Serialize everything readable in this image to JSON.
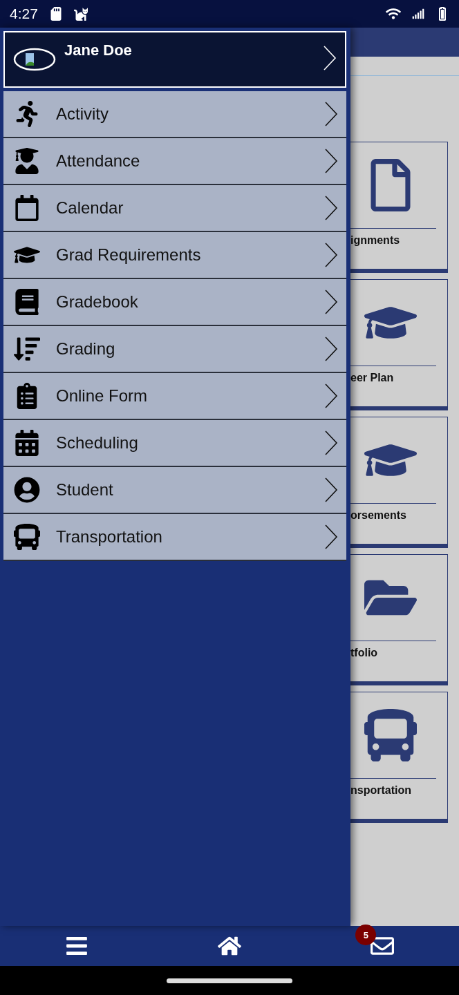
{
  "status_bar": {
    "time": "4:27"
  },
  "drawer": {
    "profile": {
      "name": "Jane Doe"
    },
    "items": [
      {
        "label": "Activity",
        "kind": "running"
      },
      {
        "label": "Attendance",
        "kind": "graduate"
      },
      {
        "label": "Calendar",
        "kind": "calendar"
      },
      {
        "label": "Grad Requirements",
        "kind": "cap"
      },
      {
        "label": "Gradebook",
        "kind": "book"
      },
      {
        "label": "Grading",
        "kind": "bars"
      },
      {
        "label": "Online Form",
        "kind": "clipboard"
      },
      {
        "label": "Scheduling",
        "kind": "schedule"
      },
      {
        "label": "Student",
        "kind": "student"
      },
      {
        "label": "Transportation",
        "kind": "bus"
      }
    ]
  },
  "background": {
    "tiles": [
      {
        "label": "ignments",
        "kind": "file"
      },
      {
        "label": "eer Plan",
        "kind": "cap"
      },
      {
        "label": "orsements",
        "kind": "cap"
      },
      {
        "label": "tfolio",
        "kind": "folder"
      },
      {
        "label": "nsportation",
        "kind": "bus"
      }
    ]
  },
  "bottom_nav": {
    "mail_badge": "5"
  }
}
